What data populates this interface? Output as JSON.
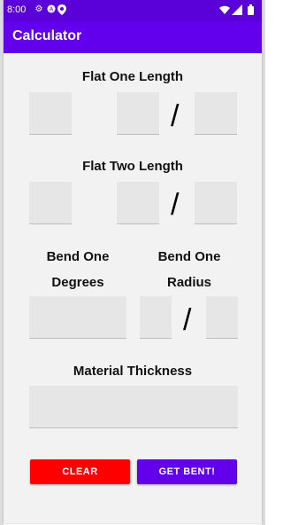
{
  "status_bar": {
    "time": "8:00",
    "icons": [
      "settings-gear-icon",
      "android-icon",
      "location-pin-icon",
      "wifi-icon",
      "signal-icon",
      "battery-icon"
    ]
  },
  "app_bar": {
    "title": "Calculator"
  },
  "sections": {
    "flat_one": {
      "label": "Flat One Length",
      "divider": "/"
    },
    "flat_two": {
      "label": "Flat Two Length",
      "divider": "/"
    },
    "bend_degrees": {
      "label_line1": "Bend One",
      "label_line2": "Degrees"
    },
    "bend_radius": {
      "label_line1": "Bend One",
      "label_line2": "Radius",
      "divider": "/"
    },
    "material": {
      "label": "Material Thickness"
    }
  },
  "buttons": {
    "clear": "CLEAR",
    "calculate": "GET BENT!"
  },
  "colors": {
    "primary": "#6200ee",
    "primary_dark": "#5a00d8",
    "clear_button": "#ff0000",
    "field_bg": "#e6e6e6"
  }
}
